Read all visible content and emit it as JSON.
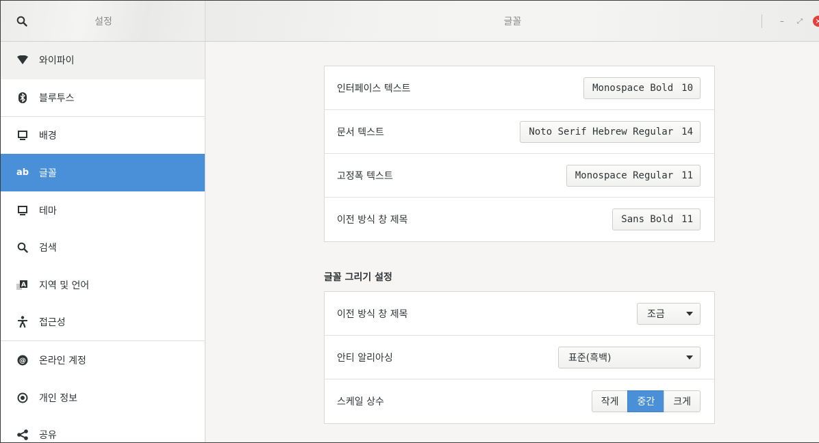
{
  "header": {
    "left_title": "설정",
    "title": "글꼴",
    "search_icon": "search-icon",
    "controls": {
      "minimize": "–",
      "restore": "⤢",
      "close": "✕"
    }
  },
  "sidebar": {
    "items": [
      {
        "label": "와이파이",
        "icon": "wifi-icon"
      },
      {
        "label": "블루투스",
        "icon": "bluetooth-icon"
      },
      {
        "label": "배경",
        "icon": "monitor-icon"
      },
      {
        "label": "글꼴",
        "icon": "font-icon",
        "icon_text": "ab"
      },
      {
        "label": "테마",
        "icon": "monitor-icon"
      },
      {
        "label": "검색",
        "icon": "search-icon"
      },
      {
        "label": "지역 및 언어",
        "icon": "language-icon",
        "icon_text": "A"
      },
      {
        "label": "접근성",
        "icon": "accessibility-icon"
      },
      {
        "label": "온라인 계정",
        "icon": "at-icon",
        "icon_text": "@"
      },
      {
        "label": "개인 정보",
        "icon": "privacy-icon"
      },
      {
        "label": "공유",
        "icon": "share-icon"
      }
    ]
  },
  "fonts": {
    "rows": [
      {
        "label": "인터페이스 텍스트",
        "font": "Monospace Bold",
        "size": "10"
      },
      {
        "label": "문서 텍스트",
        "font": "Noto Serif Hebrew Regular",
        "size": "14"
      },
      {
        "label": "고정폭 텍스트",
        "font": "Monospace Regular",
        "size": "11"
      },
      {
        "label": "이전 방식 창 제목",
        "font": "Sans Bold",
        "size": "11"
      }
    ]
  },
  "rendering": {
    "section_title": "글꼴 그리기 설정",
    "hinting": {
      "label": "이전 방식 창 제목",
      "value": "조금"
    },
    "antialiasing": {
      "label": "안티 알리아싱",
      "value": "표준(흑백)"
    },
    "scaling": {
      "label": "스케일 상수",
      "options": [
        "작게",
        "중간",
        "크게"
      ],
      "selected": "중간"
    }
  },
  "colors": {
    "accent": "#4a90d9",
    "close": "#e0413a"
  }
}
